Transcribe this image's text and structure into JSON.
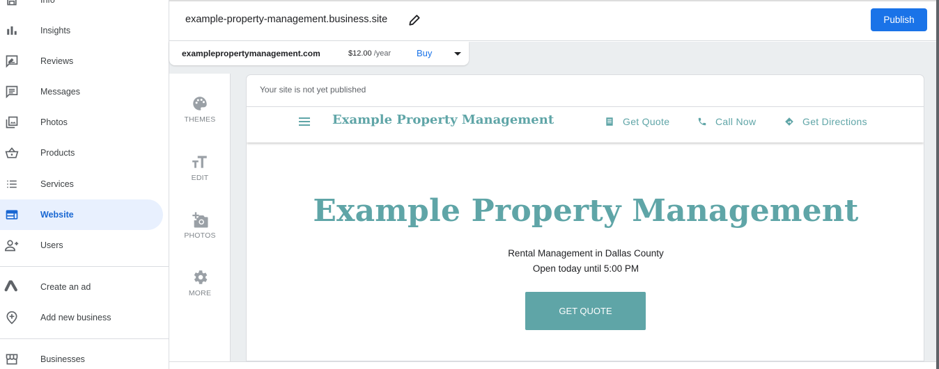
{
  "sidebar": {
    "items": [
      {
        "label": "Info",
        "icon": "storefront-icon"
      },
      {
        "label": "Insights",
        "icon": "bar-chart-icon"
      },
      {
        "label": "Reviews",
        "icon": "rate-review-icon"
      },
      {
        "label": "Messages",
        "icon": "chat-icon"
      },
      {
        "label": "Photos",
        "icon": "photo-library-icon"
      },
      {
        "label": "Products",
        "icon": "shopping-basket-icon"
      },
      {
        "label": "Services",
        "icon": "list-icon"
      },
      {
        "label": "Website",
        "icon": "web-icon",
        "active": true
      },
      {
        "label": "Users",
        "icon": "person-add-icon"
      }
    ],
    "secondary": [
      {
        "label": "Create an ad",
        "icon": "google-ads-icon"
      },
      {
        "label": "Add new business",
        "icon": "add-location-icon"
      }
    ],
    "tertiary": [
      {
        "label": "Businesses",
        "icon": "store-icon"
      }
    ]
  },
  "topbar": {
    "site_url": "example-property-management.business.site",
    "publish_label": "Publish"
  },
  "domain": {
    "name": "examplepropertymanagement.com",
    "price": "$12.00",
    "period": "/year",
    "buy_label": "Buy"
  },
  "tools": [
    {
      "label": "THEMES",
      "icon": "palette-icon"
    },
    {
      "label": "EDIT",
      "icon": "text-fields-icon"
    },
    {
      "label": "PHOTOS",
      "icon": "add-photo-icon"
    },
    {
      "label": "MORE",
      "icon": "settings-icon"
    }
  ],
  "preview": {
    "notice": "Your site is not yet published",
    "brand": "Example Property Management",
    "links": [
      {
        "label": "Get Quote",
        "icon": "receipt-icon"
      },
      {
        "label": "Call Now",
        "icon": "phone-icon"
      },
      {
        "label": "Get Directions",
        "icon": "directions-icon"
      }
    ],
    "hero_title": "Example Property Management",
    "hero_subtitle": "Rental Management in Dallas County",
    "hours": "Open today until 5:00 PM",
    "cta_label": "GET QUOTE"
  },
  "colors": {
    "accent": "#1a73e8",
    "theme": "#5fa5a7",
    "active_bg": "#e8f0fe"
  }
}
